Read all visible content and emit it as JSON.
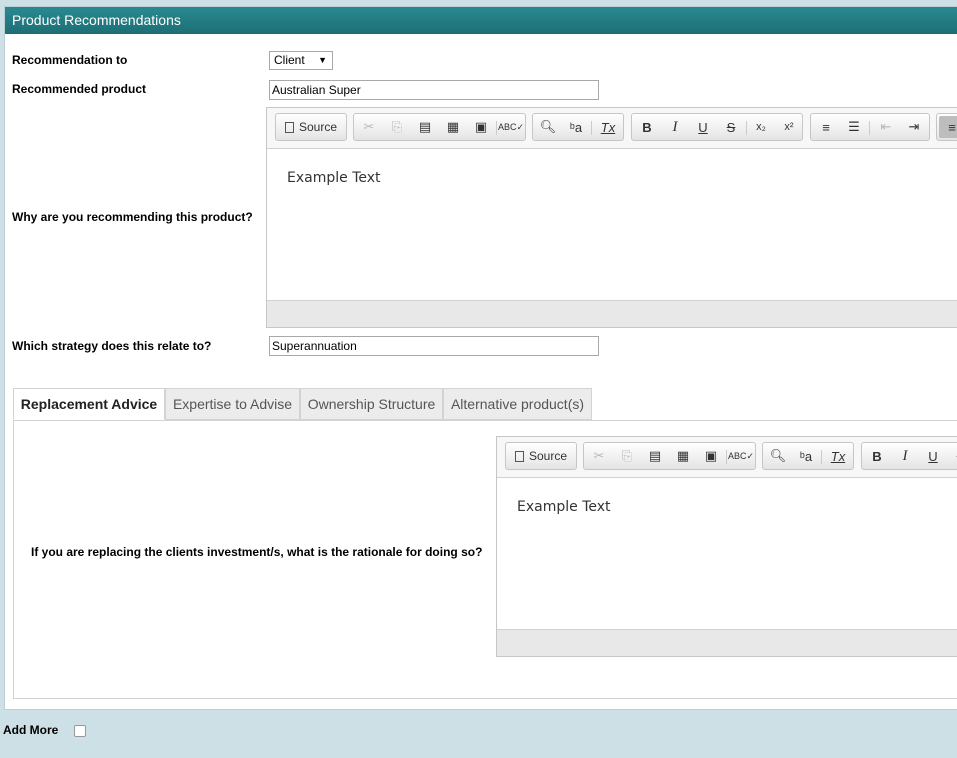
{
  "header": {
    "title": "Product Recommendations"
  },
  "form": {
    "recommendation_to_label": "Recommendation to",
    "recommendation_to_value": "Client",
    "recommended_product_label": "Recommended product",
    "recommended_product_value": "Australian Super",
    "why_label": "Why are you recommending this product?",
    "strategy_label": "Which strategy does this relate to?",
    "strategy_value": "Superannuation"
  },
  "editor1": {
    "source_label": "Source",
    "content": "Example Text"
  },
  "tabs": [
    {
      "label": "Replacement Advice",
      "active": true
    },
    {
      "label": "Expertise to Advise",
      "active": false
    },
    {
      "label": "Ownership Structure",
      "active": false
    },
    {
      "label": "Alternative product(s)",
      "active": false
    }
  ],
  "replacement": {
    "question": "If you are replacing the clients investment/s, what is the rationale for doing so?"
  },
  "editor2": {
    "source_label": "Source",
    "content": "Example Text"
  },
  "add_more": {
    "label": "Add More",
    "checked": false
  },
  "icons": {
    "cut": "✂",
    "copy": "⎘",
    "paste": "📋",
    "find": "⌕",
    "replace": "ᵇa",
    "clear_format": "Tx",
    "bold": "B",
    "italic": "I",
    "underline": "U",
    "strike": "S",
    "subscript": "x₂",
    "superscript": "x²",
    "ordered_list": "≡",
    "bullet_list": "☰",
    "outdent": "⇤",
    "indent": "⇥",
    "align_left": "≡"
  },
  "colors": {
    "header_bg": "#217c82",
    "page_bg": "#cde0e6"
  }
}
